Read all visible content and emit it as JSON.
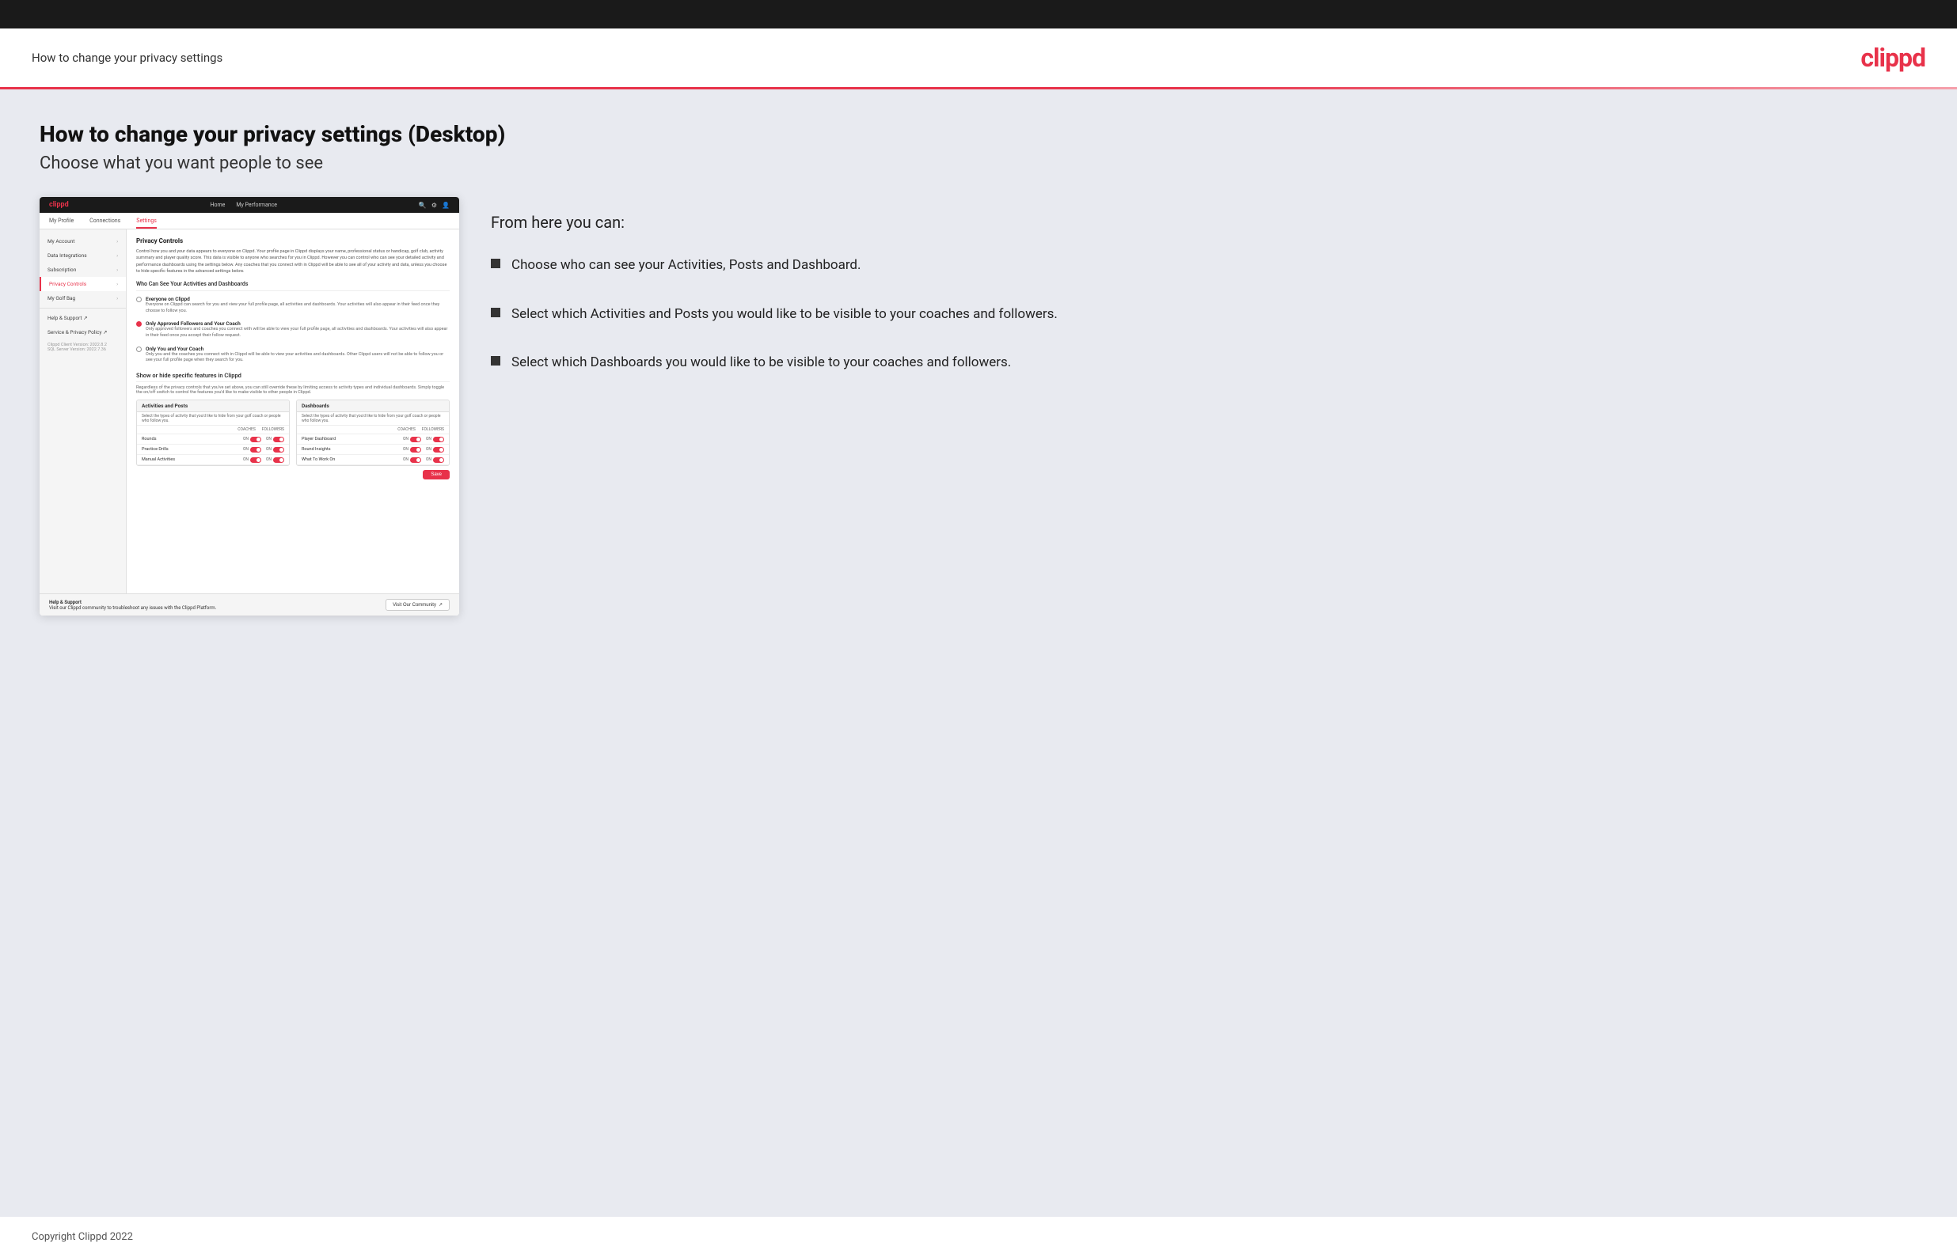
{
  "header": {
    "title": "How to change your privacy settings",
    "logo": "clippd"
  },
  "main": {
    "page_heading": "How to change your privacy settings (Desktop)",
    "page_subheading": "Choose what you want people to see",
    "right_panel": {
      "from_here": "From here you can:",
      "bullets": [
        "Choose who can see your Activities, Posts and Dashboard.",
        "Select which Activities and Posts you would like to be visible to your coaches and followers.",
        "Select which Dashboards you would like to be visible to your coaches and followers."
      ]
    }
  },
  "mock": {
    "nav": {
      "logo": "clippd",
      "links": [
        "Home",
        "My Performance"
      ],
      "icons": [
        "🔍",
        "⚙",
        "👤"
      ]
    },
    "sub_nav": {
      "items": [
        "My Profile",
        "Connections",
        "Settings"
      ]
    },
    "sidebar": {
      "items": [
        {
          "label": "My Account",
          "active": false
        },
        {
          "label": "Data Integrations",
          "active": false
        },
        {
          "label": "Subscription",
          "active": false
        },
        {
          "label": "Privacy Controls",
          "active": true
        },
        {
          "label": "My Golf Bag",
          "active": false
        },
        {
          "label": "Help & Support",
          "active": false
        },
        {
          "label": "Service & Privacy Policy",
          "active": false
        }
      ],
      "footer": {
        "line1": "Clippd Client Version: 2022.8.2",
        "line2": "SQL Server Version: 2022.7.36"
      }
    },
    "privacy_controls": {
      "title": "Privacy Controls",
      "desc": "Control how you and your data appears to everyone on Clippd. Your profile page in Clippd displays your name, professional status or handicap, golf club, activity summary and player quality score. This data is visible to anyone who searches for you in Clippd. However you can control who can see your detailed activity and performance dashboards using the settings below. Any coaches that you connect with in Clippd will be able to see all of your activity and data, unless you choose to hide specific features in the advanced settings below.",
      "who_can_see_title": "Who Can See Your Activities and Dashboards",
      "options": [
        {
          "label": "Everyone on Clippd",
          "desc": "Everyone on Clippd can search for you and view your full profile page, all activities and dashboards. Your activities will also appear in their feed once they choose to follow you.",
          "selected": false
        },
        {
          "label": "Only Approved Followers and Your Coach",
          "desc": "Only approved followers and coaches you connect with will be able to view your full profile page, all activities and dashboards. Your activities will also appear in their feed once you accept their follow request.",
          "selected": true
        },
        {
          "label": "Only You and Your Coach",
          "desc": "Only you and the coaches you connect with in Clippd will be able to view your activities and dashboards. Other Clippd users will not be able to follow you or see your full profile page when they search for you.",
          "selected": false
        }
      ],
      "show_hide": {
        "title": "Show or hide specific features in Clippd",
        "desc": "Regardless of the privacy controls that you've set above, you can still override these by limiting access to activity types and individual dashboards. Simply toggle the on/off switch to control the features you'd like to make visible to other people in Clippd.",
        "activities_panel": {
          "header": "Activities and Posts",
          "desc": "Select the types of activity that you'd like to hide from your golf coach or people who follow you.",
          "cols": [
            "COACHES",
            "FOLLOWERS"
          ],
          "rows": [
            {
              "label": "Rounds",
              "coaches": "ON",
              "followers": "ON"
            },
            {
              "label": "Practice Drills",
              "coaches": "ON",
              "followers": "ON"
            },
            {
              "label": "Manual Activities",
              "coaches": "ON",
              "followers": "ON"
            }
          ]
        },
        "dashboards_panel": {
          "header": "Dashboards",
          "desc": "Select the types of activity that you'd like to hide from your golf coach or people who follow you.",
          "cols": [
            "COACHES",
            "FOLLOWERS"
          ],
          "rows": [
            {
              "label": "Player Dashboard",
              "coaches": "ON",
              "followers": "ON"
            },
            {
              "label": "Round Insights",
              "coaches": "ON",
              "followers": "ON"
            },
            {
              "label": "What To Work On",
              "coaches": "ON",
              "followers": "ON"
            }
          ]
        }
      },
      "save_label": "Save"
    },
    "help_bar": {
      "title": "Help & Support",
      "desc": "Visit our Clippd community to troubleshoot any issues with the Clippd Platform.",
      "btn_label": "Visit Our Community"
    }
  },
  "footer": {
    "text": "Copyright Clippd 2022"
  }
}
